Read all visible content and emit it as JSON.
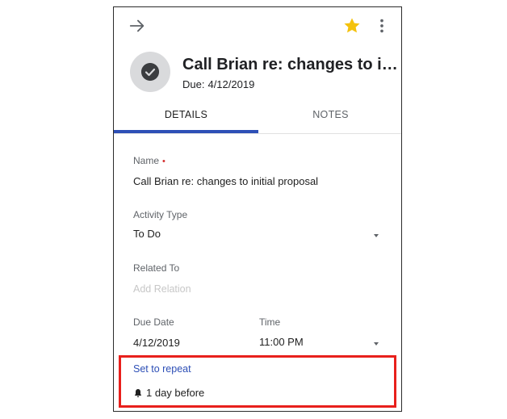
{
  "header": {
    "title": "Call Brian re: changes to initial proposal",
    "due_label": "Due:",
    "due_value": "4/12/2019"
  },
  "tabs": [
    {
      "label": "DETAILS",
      "active": true
    },
    {
      "label": "NOTES",
      "active": false
    }
  ],
  "fields": {
    "name_label": "Name",
    "name_required_mark": "•",
    "name_value": "Call Brian re: changes to initial proposal",
    "activity_type_label": "Activity Type",
    "activity_type_value": "To Do",
    "related_to_label": "Related To",
    "related_to_placeholder": "Add Relation",
    "due_date_label": "Due Date",
    "due_date_value": "4/12/2019",
    "time_label": "Time",
    "time_value": "11:00 PM"
  },
  "repeat": {
    "link_label": "Set to repeat",
    "reminder_text": "1 day before"
  },
  "icons": {
    "back": "arrow-right-icon",
    "star": "star-icon",
    "more": "more-vert-icon",
    "status": "check-circle-icon",
    "reminder": "bell-icon"
  },
  "colors": {
    "accent": "#2d4fb6",
    "star": "#f4c20d",
    "highlight": "#e8201c",
    "required": "#d32f2f"
  }
}
